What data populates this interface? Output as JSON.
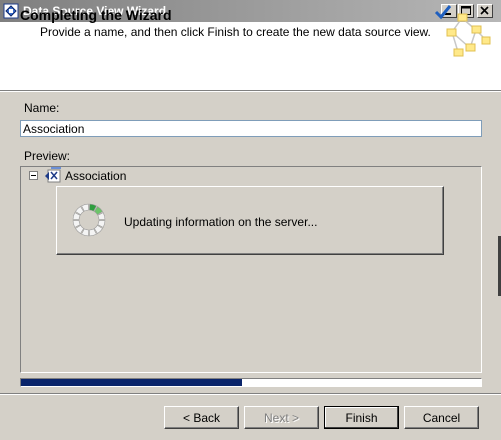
{
  "window": {
    "title": "Data Source View Wizard",
    "icons": {
      "app": "cube-icon",
      "minimize": "minimize-icon",
      "maximize": "maximize-icon",
      "close": "close-icon"
    }
  },
  "header": {
    "title": "Completing the Wizard",
    "subtitle": "Provide a name, and then click Finish to create the new data source view.",
    "art_icon": "data-source-view-icon"
  },
  "name": {
    "label": "Name:",
    "value": "Association"
  },
  "preview": {
    "label": "Preview:",
    "tree": [
      {
        "label": "Association",
        "expanded": true,
        "icon": "data-source-view-icon"
      }
    ]
  },
  "progress_dialog": {
    "message": "Updating information on the server...",
    "icon": "spinner-icon"
  },
  "progress": {
    "fraction": 0.48
  },
  "buttons": {
    "back": "< Back",
    "next": "Next >",
    "finish": "Finish",
    "cancel": "Cancel"
  },
  "colors": {
    "titlebar": "#7f7f7f",
    "progress_fill": "#0a246a",
    "dialog_bg": "#d4d0c8"
  }
}
